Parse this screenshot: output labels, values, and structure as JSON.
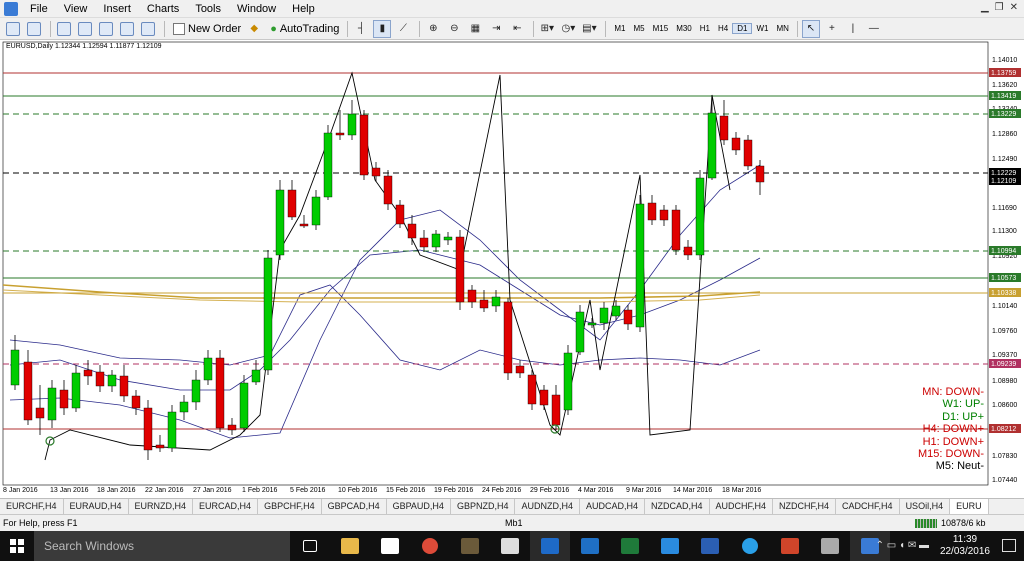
{
  "menu": [
    "File",
    "View",
    "Insert",
    "Charts",
    "Tools",
    "Window",
    "Help"
  ],
  "toolbar": {
    "new_order": "New Order",
    "autotrading": "AutoTrading",
    "timeframes": [
      "M1",
      "M5",
      "M15",
      "M30",
      "H1",
      "H4",
      "D1",
      "W1",
      "MN"
    ],
    "active_timeframe": "D1"
  },
  "chart": {
    "title": "EURUSD,Daily  1.12344 1.12594 1.11877 1.12109",
    "price_labels": [
      "1.14010",
      "1.13620",
      "1.13240",
      "1.12860",
      "1.12490",
      "1.12109",
      "1.11690",
      "1.11300",
      "1.10920",
      "1.10530",
      "1.10140",
      "1.09760",
      "1.09370",
      "1.08980",
      "1.08600",
      "1.08210",
      "1.07830",
      "1.07440"
    ],
    "hline_labels": [
      "1.13759",
      "1.13419",
      "1.13229",
      "1.12229",
      "1.10994",
      "1.10573",
      "1.10338",
      "1.09239",
      "1.08212"
    ],
    "current_price": "1.12109",
    "date_labels": [
      "8 Jan 2016",
      "13 Jan 2016",
      "18 Jan 2016",
      "22 Jan 2016",
      "27 Jan 2016",
      "1 Feb 2016",
      "5 Feb 2016",
      "10 Feb 2016",
      "15 Feb 2016",
      "19 Feb 2016",
      "24 Feb 2016",
      "29 Feb 2016",
      "4 Mar 2016",
      "9 Mar 2016",
      "14 Mar 2016",
      "18 Mar 2016"
    ],
    "trend": [
      {
        "label": "MN: DOWN-",
        "color": "#cc0000"
      },
      {
        "label": "W1: UP-",
        "color": "#008000"
      },
      {
        "label": "D1: UP+",
        "color": "#008000"
      },
      {
        "label": "H4: DOWN+",
        "color": "#cc0000"
      },
      {
        "label": "H1: DOWN+",
        "color": "#cc0000"
      },
      {
        "label": "M15: DOWN-",
        "color": "#cc0000"
      },
      {
        "label": "M5: Neut-",
        "color": "#000000"
      }
    ]
  },
  "tabs": [
    "EURCHF,H4",
    "EURAUD,H4",
    "EURNZD,H4",
    "EURCAD,H4",
    "GBPCHF,H4",
    "GBPCAD,H4",
    "GBPAUD,H4",
    "GBPNZD,H4",
    "AUDNZD,H4",
    "AUDCAD,H4",
    "NZDCAD,H4",
    "AUDCHF,H4",
    "NZDCHF,H4",
    "CADCHF,H4",
    "USOil,H4",
    "EURU"
  ],
  "active_tab": "EURU",
  "status": {
    "help": "For Help, press F1",
    "profile": "Mb1",
    "traffic": "10878/6 kb"
  },
  "taskbar": {
    "search_placeholder": "Search Windows",
    "time": "11:39",
    "date": "22/03/2016"
  },
  "colors": {
    "up": "#00cc00",
    "down": "#e00000"
  }
}
